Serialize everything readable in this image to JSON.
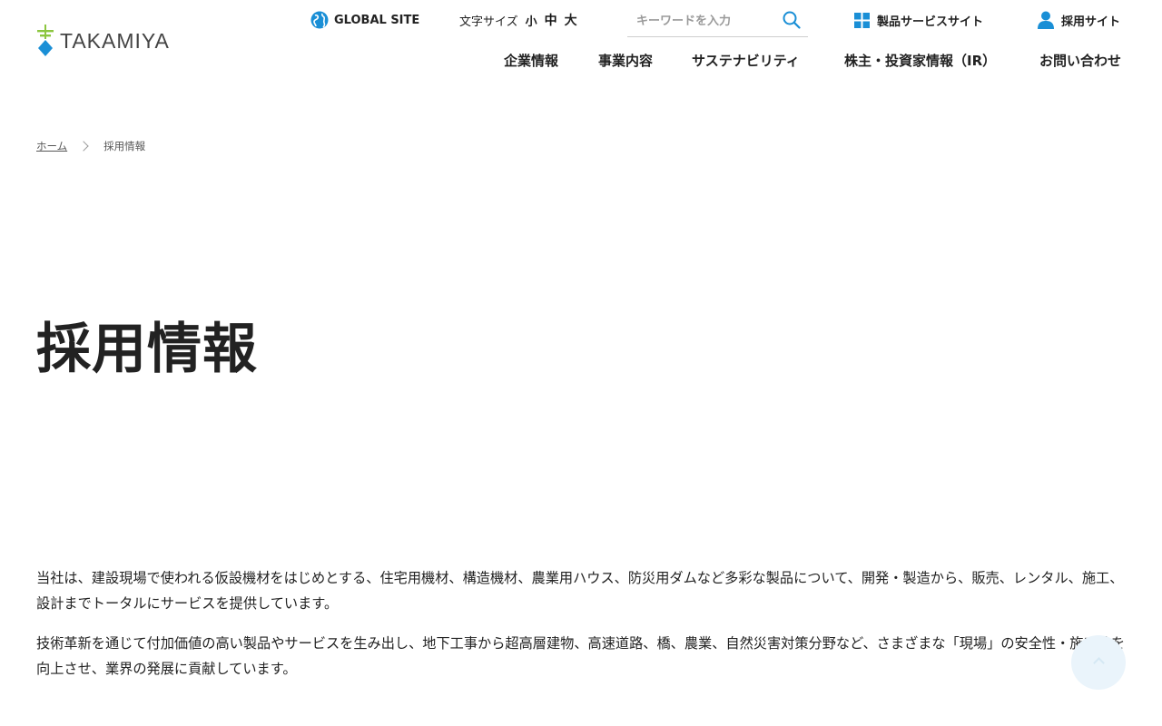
{
  "colors": {
    "brand_blue": "#1a8fd6",
    "brand_green": "#8cc63f",
    "text": "#222222"
  },
  "logo": {
    "text": "TAKAMIYA"
  },
  "utility": {
    "global_site": "GLOBAL SITE",
    "font_size_label": "文字サイズ",
    "font_small": "小",
    "font_medium": "中",
    "font_large": "大",
    "search_placeholder": "キーワードを入力",
    "products_site": "製品サービスサイト",
    "recruit_site": "採用サイト"
  },
  "nav": [
    {
      "label": "企業情報"
    },
    {
      "label": "事業内容"
    },
    {
      "label": "サステナビリティ"
    },
    {
      "label": "株主・投資家情報（IR）"
    },
    {
      "label": "お問い合わせ"
    }
  ],
  "breadcrumb": {
    "home": "ホーム",
    "current": "採用情報"
  },
  "page_title": "採用情報",
  "intro": [
    "当社は、建設現場で使われる仮設機材をはじめとする、住宅用機材、構造機材、農業用ハウス、防災用ダムなど多彩な製品について、開発・製造から、販売、レンタル、施工、設計までトータルにサービスを提供しています。",
    "技術革新を通じて付加価値の高い製品やサービスを生み出し、地下工事から超高層建物、高速道路、橋、農業、自然災害対策分野など、さまざまな「現場」の安全性・施工性を向上させ、業界の発展に貢献しています。"
  ],
  "icons": [
    "globe-icon",
    "search-icon",
    "grid-icon",
    "person-icon",
    "chevron-right-icon",
    "chevron-up-icon"
  ]
}
